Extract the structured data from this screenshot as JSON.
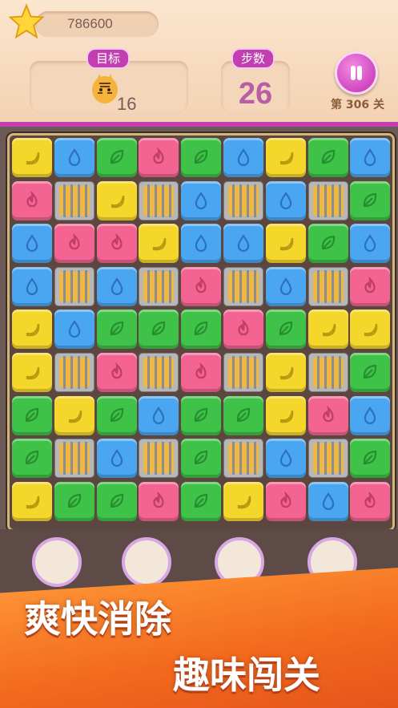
{
  "hud": {
    "score": "786600",
    "target_label": "目标",
    "target_count": "16",
    "moves_label": "步数",
    "moves_remaining": "26",
    "level_label": "第 306 关"
  },
  "board": {
    "rows": 9,
    "cols": 9,
    "cells": [
      [
        "yellow",
        "blue",
        "green",
        "pink",
        "green",
        "blue",
        "yellow",
        "green",
        "blue"
      ],
      [
        "pink",
        "caged",
        "yellow",
        "caged",
        "blue",
        "caged",
        "blue",
        "caged",
        "green"
      ],
      [
        "blue",
        "pink",
        "pink",
        "yellow",
        "blue",
        "blue",
        "yellow",
        "green",
        "blue"
      ],
      [
        "blue",
        "caged",
        "blue",
        "caged",
        "pink",
        "caged",
        "blue",
        "caged",
        "pink"
      ],
      [
        "yellow",
        "blue",
        "green",
        "green",
        "green",
        "pink",
        "green",
        "yellow",
        "yellow"
      ],
      [
        "yellow",
        "caged",
        "pink",
        "caged",
        "pink",
        "caged",
        "yellow",
        "caged",
        "green"
      ],
      [
        "green",
        "yellow",
        "green",
        "blue",
        "green",
        "green",
        "yellow",
        "pink",
        "blue"
      ],
      [
        "green",
        "caged",
        "blue",
        "caged",
        "green",
        "caged",
        "blue",
        "caged",
        "green"
      ],
      [
        "yellow",
        "green",
        "green",
        "pink",
        "green",
        "yellow",
        "pink",
        "blue",
        "pink"
      ]
    ],
    "tile_icons": {
      "yellow": "banana-icon",
      "blue": "water-drop-icon",
      "green": "leaf-icon",
      "pink": "flame-icon",
      "caged": "caged-tiger-icon"
    },
    "colors": {
      "yellow": "#f5d62b",
      "blue": "#4aa6f0",
      "green": "#3fc248",
      "pink": "#f36493"
    }
  },
  "boosters": [
    "hammer-icon",
    "glove-icon",
    "crown-icon",
    "magic-icon"
  ],
  "promo": {
    "line1": "爽快消除",
    "line2": "趣味闯关"
  }
}
